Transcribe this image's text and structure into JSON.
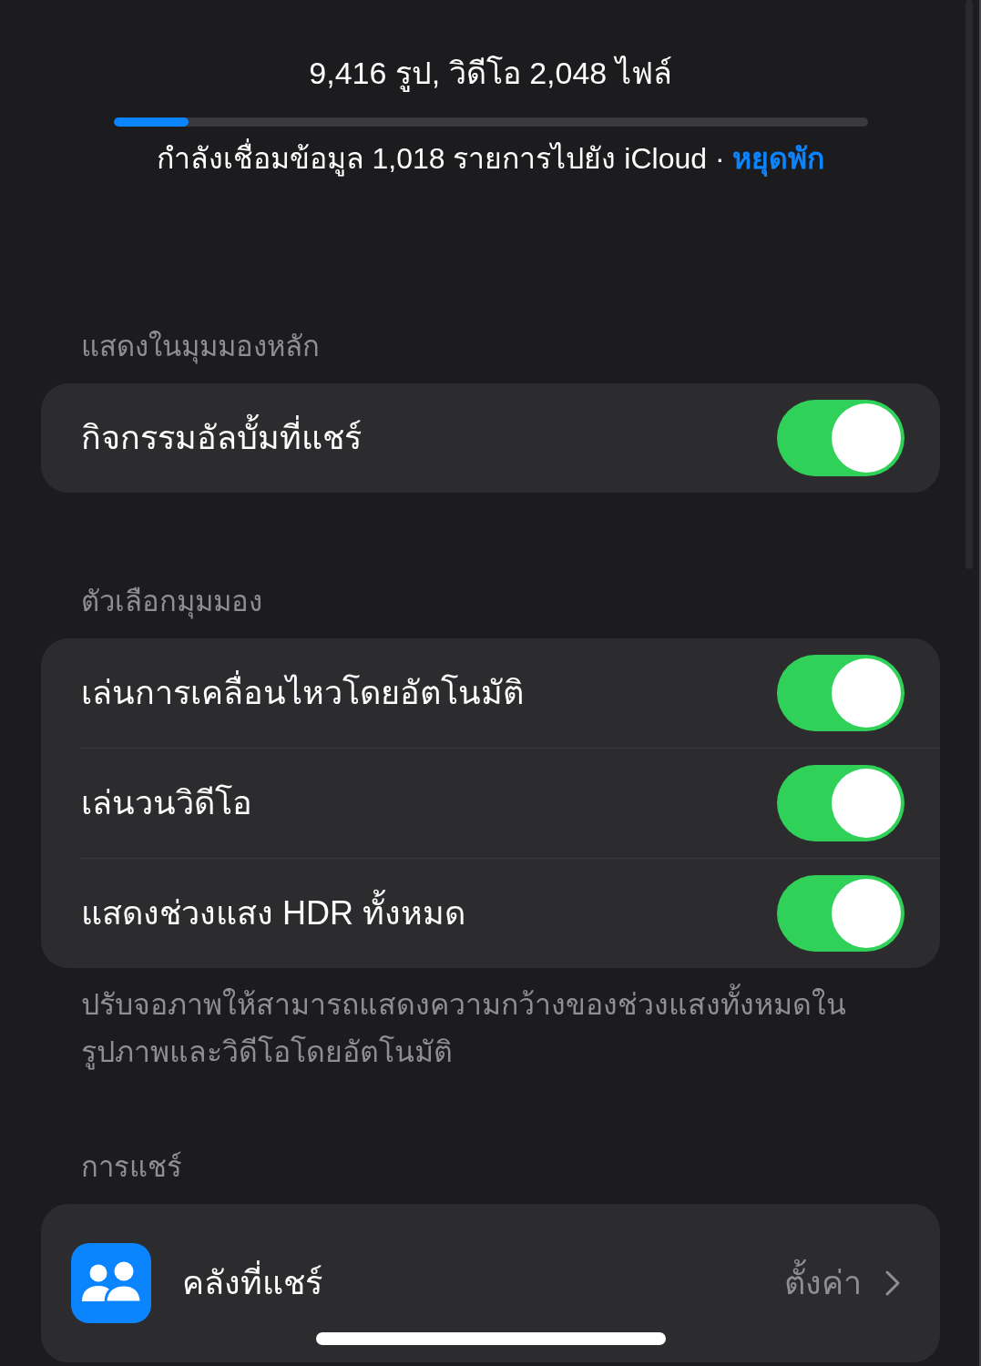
{
  "sync": {
    "summary": "9,416 รูป, วิดีโอ 2,048 ไฟล์",
    "progress": {
      "level": 0.1
    },
    "status": "กำลังเชื่อมข้อมูล 1,018 รายการไปยัง iCloud",
    "separator": "·",
    "action": "หยุดพัก"
  },
  "sections": [
    {
      "header": "แสดงในมุมมองหลัก",
      "rows": [
        {
          "kind": "toggle",
          "label": "กิจกรรมอัลบั้มที่แชร์",
          "on": true
        }
      ]
    },
    {
      "header": "ตัวเลือกมุมมอง",
      "rows": [
        {
          "kind": "toggle",
          "label": "เล่นการเคลื่อนไหวโดยอัตโนมัติ",
          "on": true
        },
        {
          "kind": "toggle",
          "label": "เล่นวนวิดีโอ",
          "on": true
        },
        {
          "kind": "toggle",
          "label": "แสดงช่วงแสง HDR ทั้งหมด",
          "on": true
        }
      ],
      "footer": "ปรับจอภาพให้สามารถแสดงความกว้างของช่วงแสงทั้งหมดในรูปภาพและวิดีโอโดยอัตโนมัติ"
    },
    {
      "header": "การแชร์",
      "rows": [
        {
          "kind": "link",
          "label": "คลังที่แชร์",
          "value": "ตั้งค่า"
        }
      ]
    }
  ]
}
